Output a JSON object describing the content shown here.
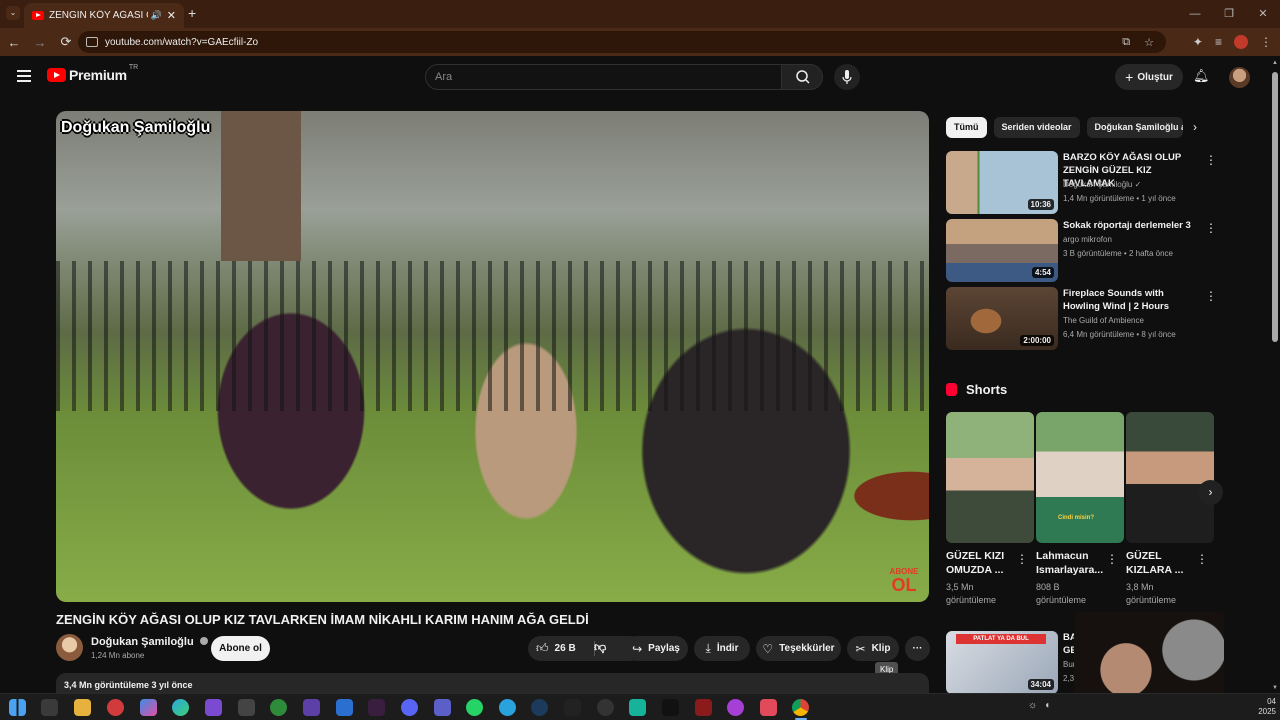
{
  "browser": {
    "tab_title": "ZENGİN KÖY AĞASI OLUP K",
    "tab_close": "✕",
    "new_tab": "+",
    "url": "youtube.com/watch?v=GAEcfiil-Zo",
    "back_icon": "←",
    "forward_icon": "→",
    "reload_icon": "⟳"
  },
  "yt_header": {
    "logo_text": "Premium",
    "country_code": "TR",
    "search_placeholder": "Ara",
    "create_label": "Oluştur",
    "create_icon": "+"
  },
  "video": {
    "overlay_title": "Doğukan Şamiloğlu",
    "overlay_abone": "ABONE",
    "overlay_ol": "OL",
    "title": "ZENGİN KÖY AĞASI OLUP KIZ TAVLARKEN İMAM NİKAHLI KARIM HANIM AĞA GELDİ",
    "channel_name": "Doğukan Şamiloğlu",
    "subscribers": "1,24 Mn abone",
    "subscribe_label": "Abone ol",
    "like_count": "26 B",
    "share_label": "Paylaş",
    "download_label": "İndir",
    "thanks_label": "Teşekkürler",
    "clip_label": "Klip",
    "clip_tooltip": "Klip",
    "more_label": "···",
    "description_summary": "3,4 Mn görüntüleme  3 yıl önce"
  },
  "chips": [
    "Tümü",
    "Seriden videolar",
    "Doğukan Şamiloğlu a"
  ],
  "recommendations": [
    {
      "title": "BARZO KÖY AĞASI OLUP ZENGİN GÜZEL KIZ TAVLAMAK",
      "channel": "Doğukan Şamiloğlu",
      "meta": "1,4 Mn görüntüleme • 1 yıl önce",
      "duration": "10:36"
    },
    {
      "title": "Sokak röportajı derlemeler 3",
      "channel": "argo mikrofon",
      "meta": "3 B görüntüleme • 2 hafta önce",
      "duration": "4:54"
    },
    {
      "title": "Fireplace Sounds with Howling Wind | 2 Hours",
      "channel": "The Guild of Ambience",
      "meta": "6,4 Mn görüntüleme • 8 yıl önce",
      "duration": "2:00:00"
    }
  ],
  "shorts": {
    "heading": "Shorts",
    "items": [
      {
        "title": "GÜZEL KIZI OMUZDA ...",
        "views": "3,5 Mn görüntüleme"
      },
      {
        "title": "Lahmacun Ismarlayara...",
        "views": "808 B görüntüleme",
        "caption": "Cindi misin?"
      },
      {
        "title": "GÜZEL KIZLARA ...",
        "views": "3,8 Mn görüntüleme"
      }
    ]
  },
  "rec4": {
    "title_start": "BA",
    "title_line2": "GE",
    "channel": "Bura",
    "meta": "2,3 M",
    "duration": "34:04",
    "banner": "PATLAT YA DA BUL"
  },
  "taskbar": {
    "clock_time": "04",
    "clock_year": "2025"
  },
  "colors": {
    "yt_red": "#ff0000",
    "bg": "#0f0f0f",
    "chrome_frame": "#4a2a17"
  }
}
